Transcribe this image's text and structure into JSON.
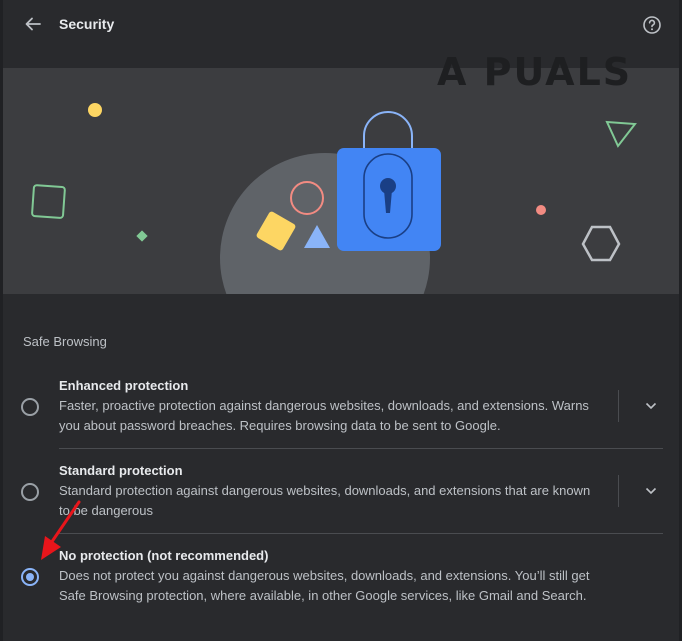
{
  "header": {
    "title": "Security"
  },
  "watermark": "A PUALS",
  "safe_browsing": {
    "section_title": "Safe Browsing",
    "options": [
      {
        "title": "Enhanced protection",
        "description": "Faster, proactive protection against dangerous websites, downloads, and extensions. Warns you about password breaches. Requires browsing data to be sent to Google.",
        "selected": false,
        "expandable": true
      },
      {
        "title": "Standard protection",
        "description": "Standard protection against dangerous websites, downloads, and extensions that are known to be dangerous",
        "selected": false,
        "expandable": true
      },
      {
        "title": "No protection (not recommended)",
        "description": "Does not protect you against dangerous websites, downloads, and extensions. You’ll still get Safe Browsing protection, where available, in other Google services, like Gmail and Search.",
        "selected": true,
        "expandable": false
      }
    ]
  },
  "icons": {
    "back": "arrow-left-icon",
    "help": "help-circle-icon",
    "expand": "chevron-down-icon",
    "lock": "lock-icon"
  },
  "colors": {
    "accent": "#8ab4f8",
    "lock_blue": "#4285f4",
    "annotation_arrow": "#e8151b"
  }
}
